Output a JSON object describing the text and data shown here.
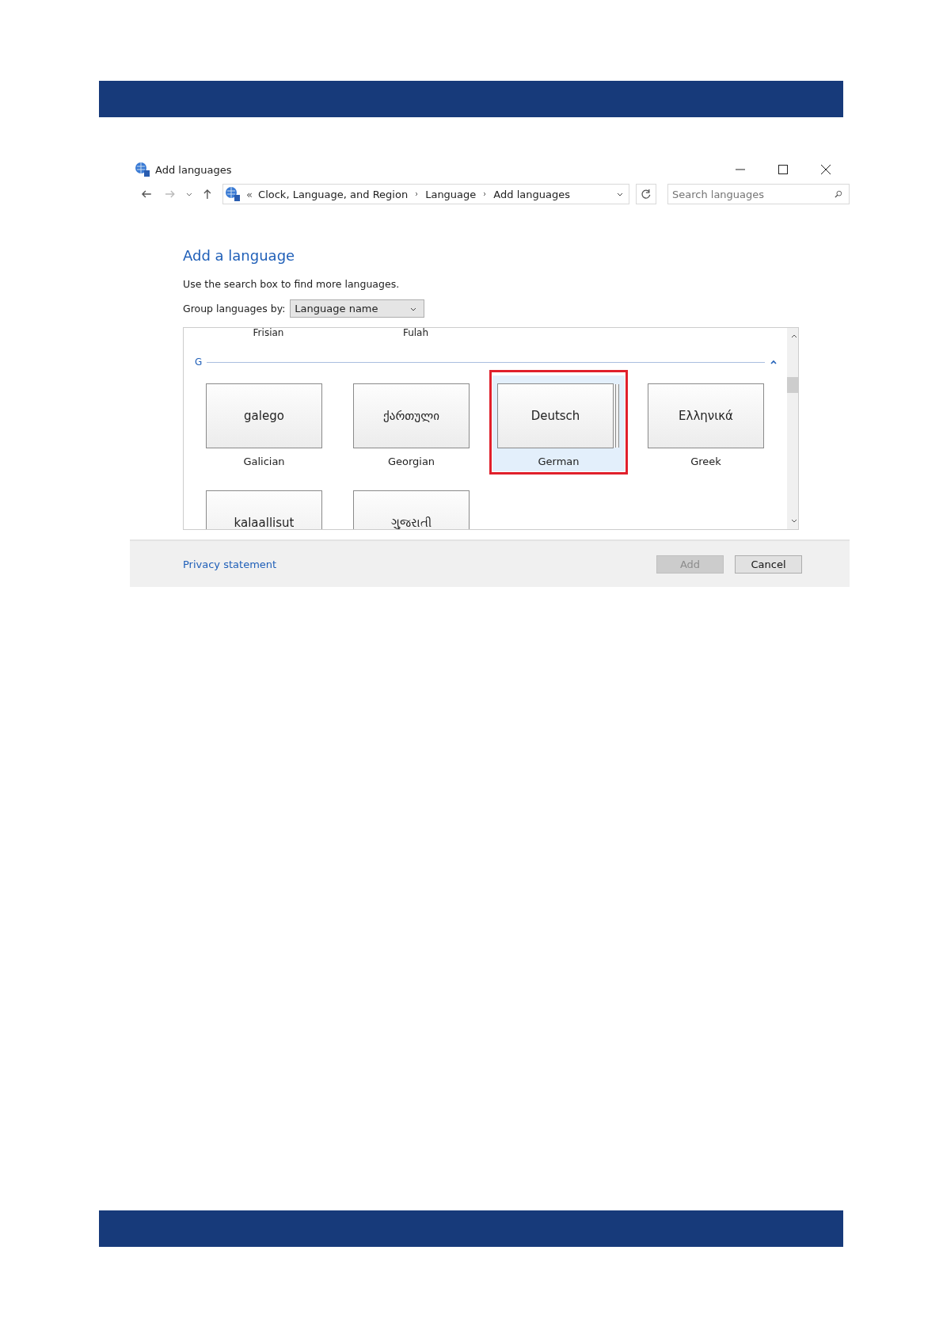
{
  "window": {
    "title": "Add languages"
  },
  "address_bar": {
    "separator": "«",
    "path": [
      "Clock, Language, and Region",
      "Language",
      "Add languages"
    ]
  },
  "search": {
    "placeholder": "Search languages"
  },
  "heading": "Add a language",
  "hint": "Use the search box to find more languages.",
  "group_by": {
    "label": "Group languages by:",
    "value": "Language name"
  },
  "partial_row": [
    "Frisian",
    "Fulah"
  ],
  "group": {
    "letter": "G",
    "expanded": true
  },
  "languages": [
    {
      "native": "galego",
      "name": "Galician",
      "selected": false,
      "highlighted": false,
      "stacked": false
    },
    {
      "native": "ქართული",
      "name": "Georgian",
      "selected": false,
      "highlighted": false,
      "stacked": false
    },
    {
      "native": "Deutsch",
      "name": "German",
      "selected": true,
      "highlighted": true,
      "stacked": true
    },
    {
      "native": "Ελληνικά",
      "name": "Greek",
      "selected": false,
      "highlighted": false,
      "stacked": false
    },
    {
      "native": "kalaallisut",
      "selected": false,
      "highlighted": false,
      "stacked": false
    },
    {
      "native": "ગુજરાતી",
      "selected": false,
      "highlighted": false,
      "stacked": false
    }
  ],
  "footer": {
    "link": "Privacy statement",
    "buttons": [
      {
        "label": "Add",
        "disabled": true
      },
      {
        "label": "Cancel",
        "disabled": false
      }
    ]
  }
}
